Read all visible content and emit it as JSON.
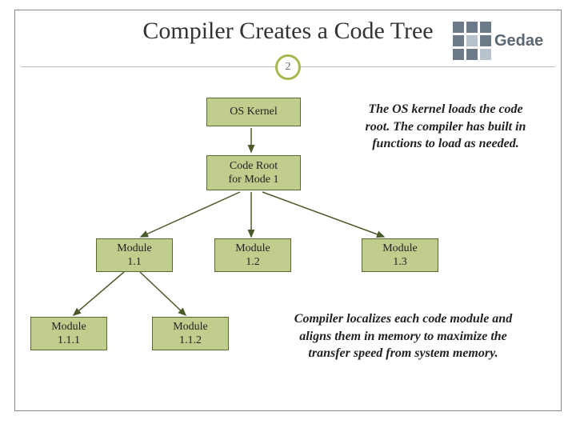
{
  "title": "Compiler Creates a Code Tree",
  "page_number": "2",
  "logo": {
    "text": "Gedae"
  },
  "nodes": {
    "os_kernel": "OS Kernel",
    "code_root_l1": "Code Root",
    "code_root_l2": "for Mode 1",
    "m11_l1": "Module",
    "m11_l2": "1.1",
    "m12_l1": "Module",
    "m12_l2": "1.2",
    "m13_l1": "Module",
    "m13_l2": "1.3",
    "m111_l1": "Module",
    "m111_l2": "1.1.1",
    "m112_l1": "Module",
    "m112_l2": "1.1.2"
  },
  "callouts": {
    "top": "The OS kernel loads the code root. The compiler has built in functions to load as needed.",
    "bottom": "Compiler localizes each code module and aligns them in memory to maximize the transfer speed from system memory."
  },
  "colors": {
    "node_fill": "#c0cd8d",
    "node_border": "#556b2f",
    "accent_ring": "#a7b84f",
    "arrow": "#4a5a2a"
  }
}
